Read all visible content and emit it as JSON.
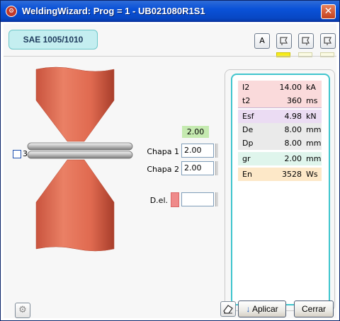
{
  "window": {
    "title": "WeldingWizard: Prog = 1 - UB021080R1S1",
    "app_icon": "welding-icon",
    "close_icon": "close-icon"
  },
  "material": "SAE 1005/1010",
  "mode_buttons": [
    {
      "label": "A",
      "icon": "auto-icon"
    },
    {
      "label": "",
      "icon": "flag-1-icon"
    },
    {
      "label": "",
      "icon": "flag-2-icon"
    },
    {
      "label": "",
      "icon": "flag-3-icon"
    }
  ],
  "indicators": [
    {
      "active": true,
      "color": "#f6ec1a"
    },
    {
      "active": false,
      "color": "#fbfbe3"
    },
    {
      "active": false,
      "color": "#fbfbe3"
    }
  ],
  "layers": {
    "checkbox_checked": false,
    "count": "3"
  },
  "thickness": {
    "total": "2.00",
    "chapa1_label": "Chapa 1",
    "chapa1_value": "2.00",
    "chapa2_label": "Chapa 2",
    "chapa2_value": "2.00",
    "del_label": "D.el.",
    "del_value": "",
    "del_color": "#ef8a8a"
  },
  "params": [
    {
      "name": "I2",
      "value": "14.00",
      "unit": "kA",
      "color": "#fadadb"
    },
    {
      "name": "t2",
      "value": "360",
      "unit": "ms",
      "color": "#fadadb"
    },
    {
      "name": "Esf",
      "value": "4.98",
      "unit": "kN",
      "color": "#ebdcf3"
    },
    {
      "name": "De",
      "value": "8.00",
      "unit": "mm",
      "color": "#eaeaea"
    },
    {
      "name": "Dp",
      "value": "8.00",
      "unit": "mm",
      "color": "#eaeaea"
    },
    {
      "name": "gr",
      "value": "2.00",
      "unit": "mm",
      "color": "#dff5ec"
    },
    {
      "name": "En",
      "value": "3528",
      "unit": "Ws",
      "color": "#fde8c8"
    }
  ],
  "buttons": {
    "settings_icon": "gear-icon",
    "eraser_icon": "eraser-icon",
    "apply_label": "Aplicar",
    "apply_icon": "arrow-down-icon",
    "close_label": "Cerrar"
  },
  "colors": {
    "titlebar": "#0a52d8",
    "accent_teal": "#3fc5cd",
    "electrode": "#e07055"
  }
}
